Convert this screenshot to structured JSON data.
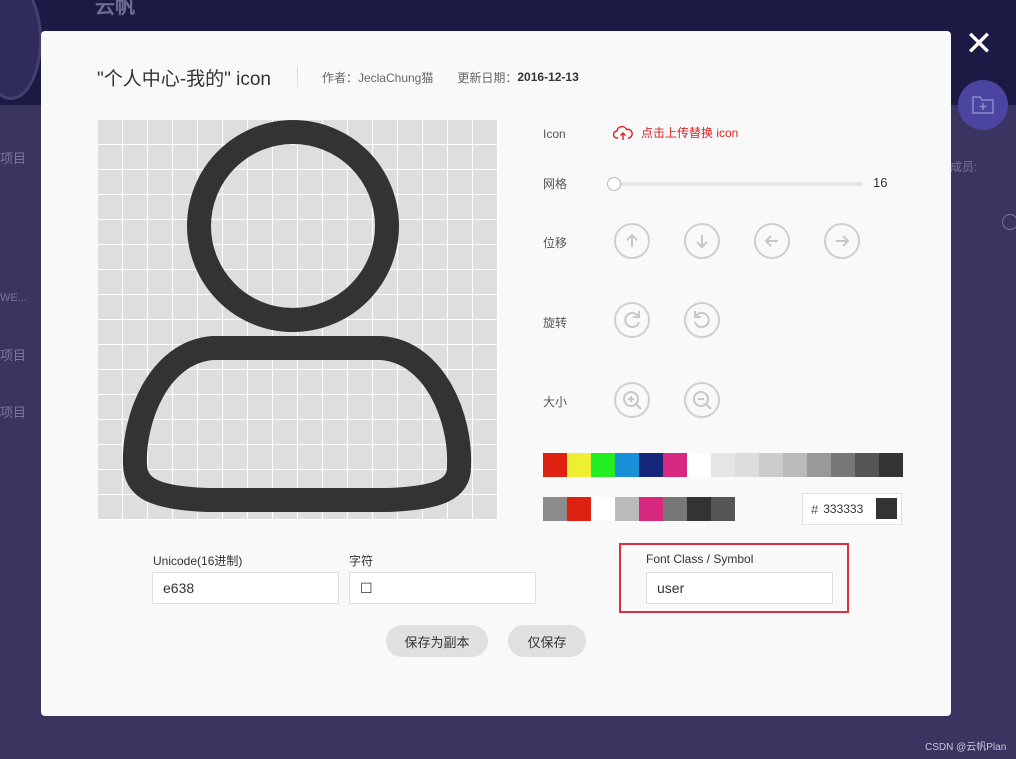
{
  "background": {
    "brand": "云帆",
    "side_items": [
      "项目",
      "WE...",
      "项目",
      "项目"
    ],
    "members_label": "成员:"
  },
  "close_label": "✕",
  "watermark": "CSDN @云帆Plan",
  "modal": {
    "title": "\"个人中心-我的\" icon",
    "author_label": "作者：",
    "author_name": "JeclaChung猫",
    "date_label": "更新日期：",
    "date_value": "2016-12-13",
    "icon_label": "Icon",
    "upload_label": "点击上传替换 icon",
    "grid_label": "网格",
    "grid_value": "16",
    "move_label": "位移",
    "rotate_label": "旋转",
    "size_label": "大小",
    "move_buttons": [
      "arrow-up-icon",
      "arrow-down-icon",
      "arrow-left-icon",
      "arrow-right-icon"
    ],
    "rotate_buttons": [
      "rotate-clockwise-icon",
      "rotate-counterclockwise-icon"
    ],
    "size_buttons": [
      "zoom-in-icon",
      "zoom-out-icon"
    ],
    "palette_row1": [
      "#dd2211",
      "#eeee33",
      "#22ee22",
      "#1a90d8",
      "#16267a",
      "#d8277f",
      "#ffffff",
      "#e6e6e6",
      "#dcdcdc",
      "#cccccc",
      "#bbbbbb",
      "#999999",
      "#777777",
      "#555555",
      "#333333"
    ],
    "palette_row2": [
      "#8c8c8c",
      "#dd2211",
      "#ffffff",
      "#bbbbbb",
      "#d8277f",
      "#777777",
      "#333333",
      "#555555"
    ],
    "hex_hash": "#",
    "hex_value": "333333",
    "icon_color": "#333333",
    "unicode_label": "Unicode(16进制)",
    "unicode_value": "e638",
    "char_label": "字符",
    "char_value": "☐",
    "font_class_label": "Font Class / Symbol",
    "font_class_value": "user",
    "save_copy_label": "保存为副本",
    "save_only_label": "仅保存"
  }
}
